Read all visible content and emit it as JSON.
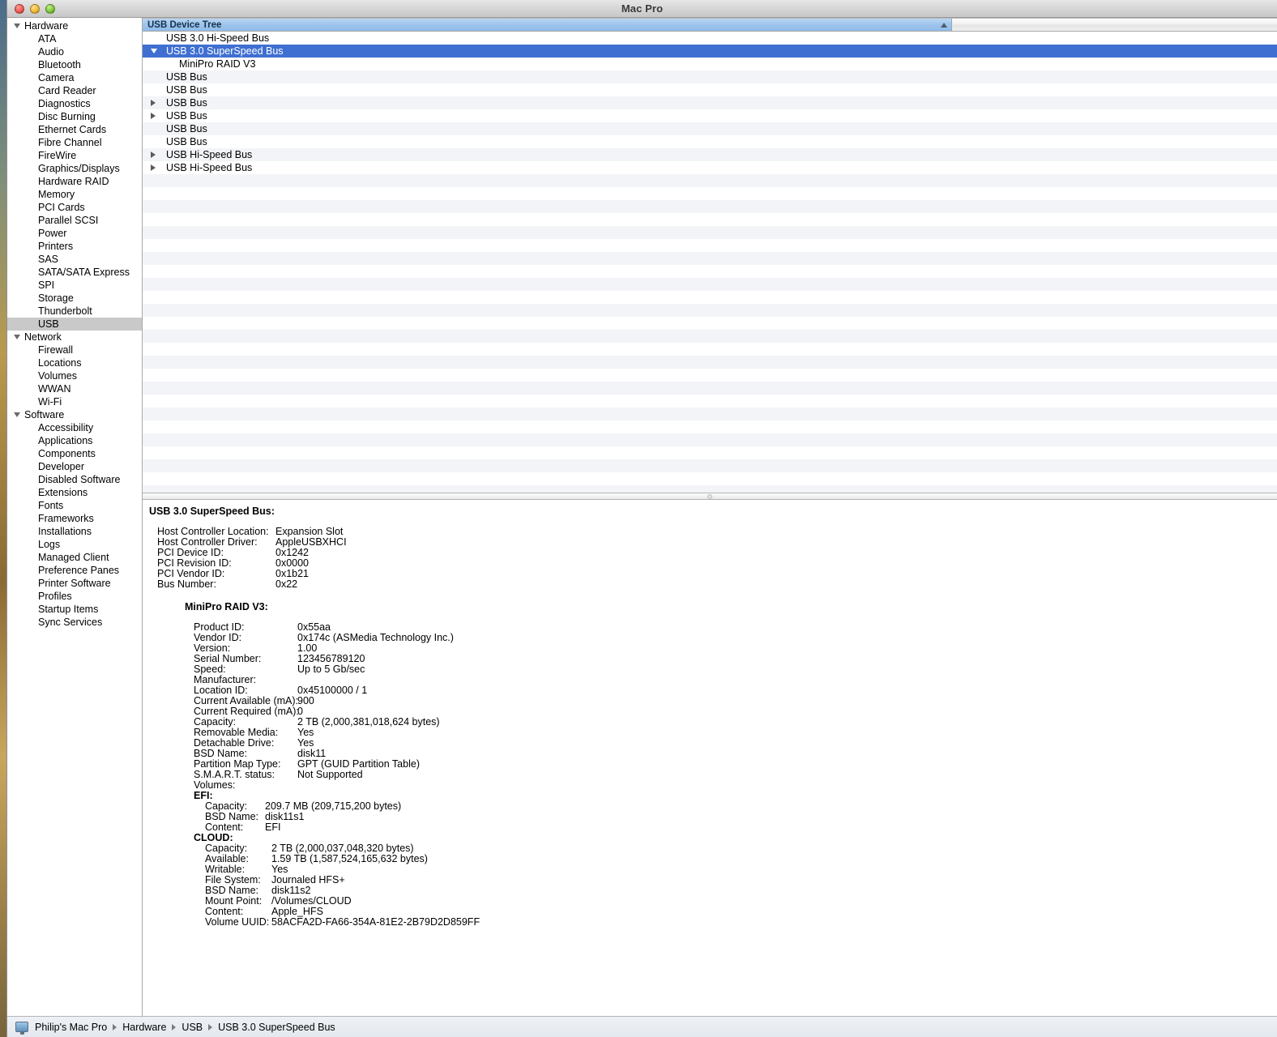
{
  "window": {
    "title": "Mac Pro",
    "traffic_lights": [
      "close-button",
      "minimize-button",
      "zoom-button"
    ]
  },
  "sidebar": {
    "items": [
      {
        "label": "Hardware",
        "type": "group",
        "expanded": true
      },
      {
        "label": "ATA",
        "type": "child"
      },
      {
        "label": "Audio",
        "type": "child"
      },
      {
        "label": "Bluetooth",
        "type": "child"
      },
      {
        "label": "Camera",
        "type": "child"
      },
      {
        "label": "Card Reader",
        "type": "child"
      },
      {
        "label": "Diagnostics",
        "type": "child"
      },
      {
        "label": "Disc Burning",
        "type": "child"
      },
      {
        "label": "Ethernet Cards",
        "type": "child"
      },
      {
        "label": "Fibre Channel",
        "type": "child"
      },
      {
        "label": "FireWire",
        "type": "child"
      },
      {
        "label": "Graphics/Displays",
        "type": "child"
      },
      {
        "label": "Hardware RAID",
        "type": "child"
      },
      {
        "label": "Memory",
        "type": "child"
      },
      {
        "label": "PCI Cards",
        "type": "child"
      },
      {
        "label": "Parallel SCSI",
        "type": "child"
      },
      {
        "label": "Power",
        "type": "child"
      },
      {
        "label": "Printers",
        "type": "child"
      },
      {
        "label": "SAS",
        "type": "child"
      },
      {
        "label": "SATA/SATA Express",
        "type": "child"
      },
      {
        "label": "SPI",
        "type": "child"
      },
      {
        "label": "Storage",
        "type": "child"
      },
      {
        "label": "Thunderbolt",
        "type": "child"
      },
      {
        "label": "USB",
        "type": "child",
        "selected": true
      },
      {
        "label": "Network",
        "type": "group",
        "expanded": true
      },
      {
        "label": "Firewall",
        "type": "child"
      },
      {
        "label": "Locations",
        "type": "child"
      },
      {
        "label": "Volumes",
        "type": "child"
      },
      {
        "label": "WWAN",
        "type": "child"
      },
      {
        "label": "Wi-Fi",
        "type": "child"
      },
      {
        "label": "Software",
        "type": "group",
        "expanded": true
      },
      {
        "label": "Accessibility",
        "type": "child"
      },
      {
        "label": "Applications",
        "type": "child"
      },
      {
        "label": "Components",
        "type": "child"
      },
      {
        "label": "Developer",
        "type": "child"
      },
      {
        "label": "Disabled Software",
        "type": "child"
      },
      {
        "label": "Extensions",
        "type": "child"
      },
      {
        "label": "Fonts",
        "type": "child"
      },
      {
        "label": "Frameworks",
        "type": "child"
      },
      {
        "label": "Installations",
        "type": "child"
      },
      {
        "label": "Logs",
        "type": "child"
      },
      {
        "label": "Managed Client",
        "type": "child"
      },
      {
        "label": "Preference Panes",
        "type": "child"
      },
      {
        "label": "Printer Software",
        "type": "child"
      },
      {
        "label": "Profiles",
        "type": "child"
      },
      {
        "label": "Startup Items",
        "type": "child"
      },
      {
        "label": "Sync Services",
        "type": "child"
      }
    ]
  },
  "tree": {
    "column_header": "USB Device Tree",
    "sort_indicator": "sort-ascending-icon",
    "rows": [
      {
        "label": "USB 3.0 Hi-Speed Bus",
        "level": 1,
        "disclosure": "none",
        "selected": false
      },
      {
        "label": "USB 3.0 SuperSpeed Bus",
        "level": 1,
        "disclosure": "down",
        "selected": true
      },
      {
        "label": "MiniPro RAID V3",
        "level": 2,
        "disclosure": "none",
        "selected": false
      },
      {
        "label": "USB Bus",
        "level": 1,
        "disclosure": "none",
        "selected": false
      },
      {
        "label": "USB Bus",
        "level": 1,
        "disclosure": "none",
        "selected": false
      },
      {
        "label": "USB Bus",
        "level": 1,
        "disclosure": "right",
        "selected": false
      },
      {
        "label": "USB Bus",
        "level": 1,
        "disclosure": "right",
        "selected": false
      },
      {
        "label": "USB Bus",
        "level": 1,
        "disclosure": "none",
        "selected": false
      },
      {
        "label": "USB Bus",
        "level": 1,
        "disclosure": "none",
        "selected": false
      },
      {
        "label": "USB Hi-Speed Bus",
        "level": 1,
        "disclosure": "right",
        "selected": false
      },
      {
        "label": "USB Hi-Speed Bus",
        "level": 1,
        "disclosure": "right",
        "selected": false
      }
    ]
  },
  "detail": {
    "title": "USB 3.0 SuperSpeed Bus:",
    "bus_properties": [
      {
        "key": "Host Controller Location:",
        "value": "Expansion Slot"
      },
      {
        "key": "Host Controller Driver:",
        "value": "AppleUSBXHCI"
      },
      {
        "key": "PCI Device ID:",
        "value": "0x1242"
      },
      {
        "key": "PCI Revision ID:",
        "value": "0x0000"
      },
      {
        "key": "PCI Vendor ID:",
        "value": "0x1b21"
      },
      {
        "key": "Bus Number:",
        "value": "0x22"
      }
    ],
    "device_title": "MiniPro RAID V3:",
    "device_properties": [
      {
        "key": "Product ID:",
        "value": "0x55aa"
      },
      {
        "key": "Vendor ID:",
        "value": "0x174c  (ASMedia Technology Inc.)"
      },
      {
        "key": "Version:",
        "value": " 1.00"
      },
      {
        "key": "Serial Number:",
        "value": "123456789120"
      },
      {
        "key": "Speed:",
        "value": "Up to 5 Gb/sec"
      },
      {
        "key": "Manufacturer:",
        "value": ""
      },
      {
        "key": "Location ID:",
        "value": "0x45100000 / 1"
      },
      {
        "key": "Current Available (mA):",
        "value": "900"
      },
      {
        "key": "Current Required (mA):",
        "value": "0"
      },
      {
        "key": "Capacity:",
        "value": "2 TB (2,000,381,018,624 bytes)"
      },
      {
        "key": "Removable Media:",
        "value": "Yes"
      },
      {
        "key": "Detachable Drive:",
        "value": "Yes"
      },
      {
        "key": "BSD Name:",
        "value": "disk11"
      },
      {
        "key": "Partition Map Type:",
        "value": "GPT (GUID Partition Table)"
      },
      {
        "key": "S.M.A.R.T. status:",
        "value": "Not Supported"
      }
    ],
    "volumes_label": "Volumes:",
    "volumes": [
      {
        "name": "EFI:",
        "properties": [
          {
            "key": "Capacity:",
            "value": "209.7 MB (209,715,200 bytes)"
          },
          {
            "key": "BSD Name:",
            "value": "disk11s1"
          },
          {
            "key": "Content:",
            "value": "EFI"
          }
        ]
      },
      {
        "name": "CLOUD:",
        "properties": [
          {
            "key": "Capacity:",
            "value": "2 TB (2,000,037,048,320 bytes)"
          },
          {
            "key": "Available:",
            "value": "1.59 TB (1,587,524,165,632 bytes)"
          },
          {
            "key": "Writable:",
            "value": "Yes"
          },
          {
            "key": "File System:",
            "value": "Journaled HFS+"
          },
          {
            "key": "BSD Name:",
            "value": "disk11s2"
          },
          {
            "key": "Mount Point:",
            "value": "/Volumes/CLOUD"
          },
          {
            "key": "Content:",
            "value": "Apple_HFS"
          },
          {
            "key": "Volume UUID:",
            "value": "58ACFA2D-FA66-354A-81E2-2B79D2D859FF"
          }
        ]
      }
    ]
  },
  "statusbar": {
    "icon": "computer-icon",
    "crumbs": [
      "Philip's Mac Pro",
      "Hardware",
      "USB",
      "USB 3.0 SuperSpeed Bus"
    ]
  },
  "colors": {
    "selection_blue": "#3f6fd1",
    "header_blue": "#9dc4ec",
    "sidebar_selection_gray": "#c9c9c9",
    "stripe": "#f2f4f7"
  }
}
